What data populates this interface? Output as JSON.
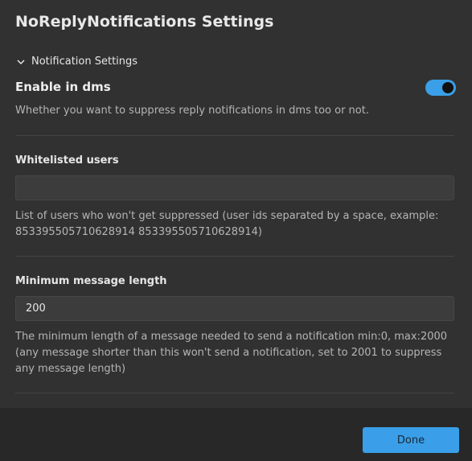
{
  "modal": {
    "title": "NoReplyNotifications Settings"
  },
  "section": {
    "title": "Notification Settings",
    "icon": "chevron-down-icon"
  },
  "enable_dms": {
    "label": "Enable in dms",
    "enabled": true,
    "description": "Whether you want to suppress reply notifications in dms too or not."
  },
  "whitelist": {
    "label": "Whitelisted users",
    "value": "",
    "description": "List of users who won't get suppressed (user ids separated by a space, example: 853395505710628914 853395505710628914)"
  },
  "min_length": {
    "label": "Minimum message length",
    "value": "200",
    "description": "The minimum length of a message needed to send a notification min:0, max:2000 (any message shorter than this won't send a notification, set to 2001 to suppress any message length)"
  },
  "footer": {
    "done_label": "Done"
  },
  "colors": {
    "accent": "#3a9fe8",
    "background": "#313131",
    "footer": "#282828"
  }
}
